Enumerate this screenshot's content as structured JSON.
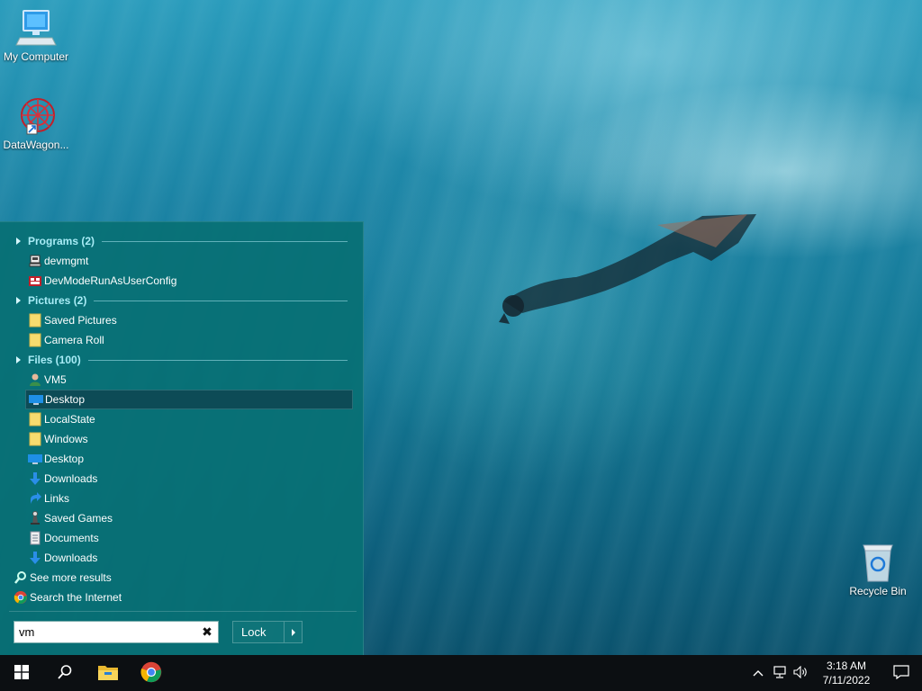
{
  "desktop": {
    "icons": [
      {
        "label": "My Computer",
        "icon": "computer-icon"
      },
      {
        "label": "DataWagon...",
        "icon": "datawagon-icon"
      },
      {
        "label": "Recycle Bin",
        "icon": "recycle-bin-icon"
      }
    ]
  },
  "start_menu": {
    "groups": [
      {
        "title": "Programs (2)",
        "items": [
          {
            "label": "devmgmt",
            "icon": "device-manager-icon"
          },
          {
            "label": "DevModeRunAsUserConfig",
            "icon": "registry-icon"
          }
        ]
      },
      {
        "title": "Pictures (2)",
        "items": [
          {
            "label": "Saved Pictures",
            "icon": "folder-icon"
          },
          {
            "label": "Camera Roll",
            "icon": "folder-icon"
          }
        ]
      },
      {
        "title": "Files (100)",
        "items": [
          {
            "label": "VM5",
            "icon": "user-folder-icon"
          },
          {
            "label": "Desktop",
            "icon": "desktop-folder-icon",
            "selected": true
          },
          {
            "label": "LocalState",
            "icon": "folder-icon"
          },
          {
            "label": "Windows",
            "icon": "folder-icon"
          },
          {
            "label": "Desktop",
            "icon": "desktop-folder-icon"
          },
          {
            "label": "Downloads",
            "icon": "downloads-icon"
          },
          {
            "label": "Links",
            "icon": "links-icon"
          },
          {
            "label": "Saved Games",
            "icon": "saved-games-icon"
          },
          {
            "label": "Documents",
            "icon": "documents-icon"
          },
          {
            "label": "Downloads",
            "icon": "downloads-icon"
          }
        ]
      }
    ],
    "see_more": "See more results",
    "search_internet": "Search the Internet",
    "search_value": "vm",
    "clear_symbol": "✖",
    "lock_label": "Lock"
  },
  "taskbar": {
    "time": "3:18 AM",
    "date": "7/11/2022"
  },
  "colors": {
    "menu_bg": "#087074",
    "group_header": "#a8ecf6",
    "selected_bg": "#0d4b56",
    "taskbar_bg": "#0c0f12"
  }
}
